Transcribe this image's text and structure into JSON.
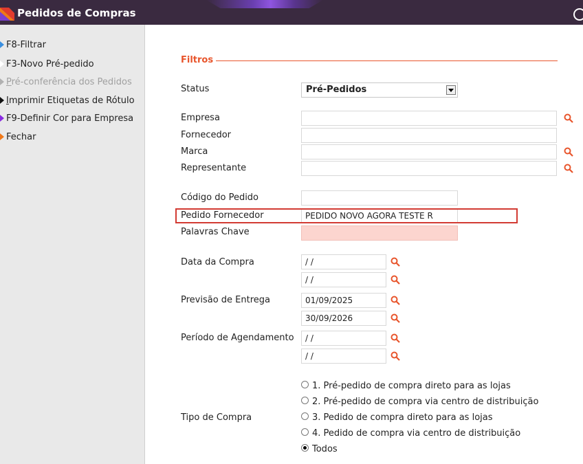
{
  "window": {
    "title": "Pedidos de Compras"
  },
  "sidebar": {
    "items": [
      {
        "label": "F8-Filtrar",
        "color": "#3a8fe0"
      },
      {
        "label": "F3-Novo Pré-pedido",
        "color": "#ffffff"
      },
      {
        "label_underline": "P",
        "label_rest": "ré-conferência dos Pedidos",
        "color": "#b0b0b0",
        "disabled": true
      },
      {
        "label_underline": "I",
        "label_rest": "mprimir Etiquetas de Rótulo",
        "color": "#111111"
      },
      {
        "label": "F9-Definir Cor para Empresa",
        "color": "#8a2be2"
      },
      {
        "label": "Fechar",
        "color": "#f07818"
      }
    ]
  },
  "filters": {
    "section_title": "Filtros",
    "status": {
      "label": "Status",
      "value": "Pré-Pedidos"
    },
    "empresa": {
      "label": "Empresa",
      "value": ""
    },
    "fornecedor": {
      "label": "Fornecedor",
      "value": ""
    },
    "marca": {
      "label": "Marca",
      "value": ""
    },
    "representante": {
      "label": "Representante",
      "value": ""
    },
    "codigo_pedido": {
      "label": "Código do Pedido",
      "value": ""
    },
    "pedido_fornecedor": {
      "label": "Pedido Fornecedor",
      "value": "PEDIDO NOVO AGORA TESTE R"
    },
    "palavras_chave": {
      "label": "Palavras Chave",
      "value": ""
    },
    "data_compra": {
      "label": "Data da Compra",
      "from": " / /",
      "to": " / /"
    },
    "previsao_entrega": {
      "label": "Previsão de Entrega",
      "from": "01/09/2025",
      "to": "30/09/2026"
    },
    "periodo_agendamento": {
      "label": "Período de Agendamento",
      "from": " / /",
      "to": " / /"
    },
    "tipo_compra": {
      "label": "Tipo de Compra",
      "options": [
        "1. Pré-pedido de compra direto para as lojas",
        "2. Pré-pedido de compra via centro de distribuição",
        "3. Pedido de compra direto para as lojas",
        "4. Pedido de compra via centro de distribuição",
        "Todos"
      ],
      "selected": "Todos"
    }
  },
  "colors": {
    "accent": "#e8552c",
    "titlebar": "#3a2a40",
    "highlight": "#d23a32"
  },
  "icons": {
    "lookup": "search-icon",
    "help": "help-icon"
  }
}
